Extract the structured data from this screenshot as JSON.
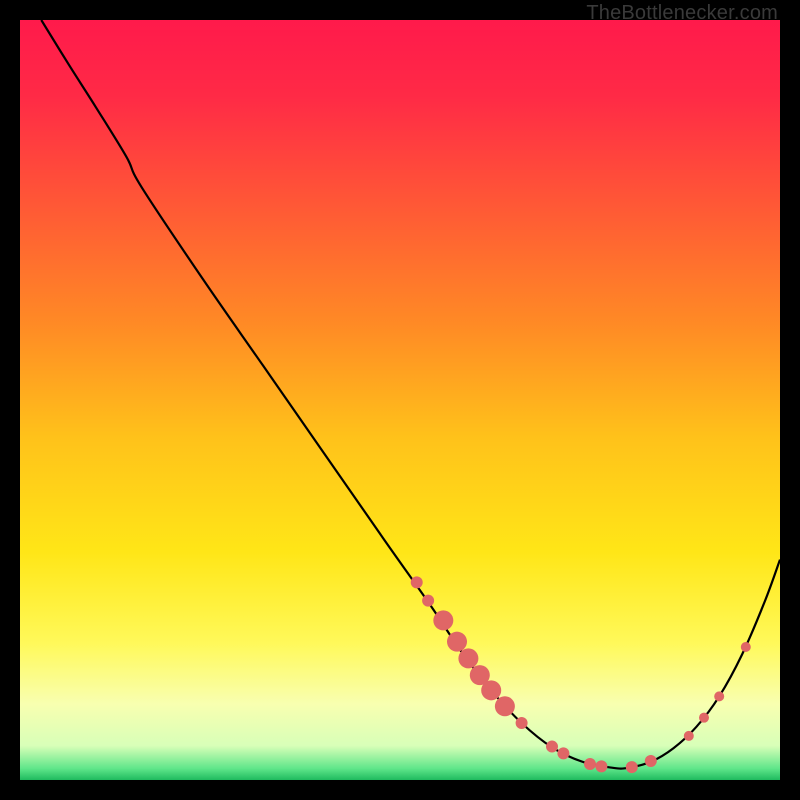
{
  "attribution": "TheBottlenecker.com",
  "chart_data": {
    "type": "line",
    "title": "",
    "xlabel": "",
    "ylabel": "",
    "xlim": [
      0,
      100
    ],
    "ylim": [
      0,
      100
    ],
    "gradient_stops": [
      {
        "offset": 0.0,
        "color": "#ff1a4b"
      },
      {
        "offset": 0.1,
        "color": "#ff2a46"
      },
      {
        "offset": 0.25,
        "color": "#ff5a35"
      },
      {
        "offset": 0.4,
        "color": "#ff8a25"
      },
      {
        "offset": 0.55,
        "color": "#ffc21a"
      },
      {
        "offset": 0.7,
        "color": "#ffe617"
      },
      {
        "offset": 0.82,
        "color": "#fff95a"
      },
      {
        "offset": 0.9,
        "color": "#f8ffb0"
      },
      {
        "offset": 0.955,
        "color": "#d8ffb8"
      },
      {
        "offset": 0.985,
        "color": "#5fe68a"
      },
      {
        "offset": 1.0,
        "color": "#1fba5e"
      }
    ],
    "curve": [
      {
        "x": 2.8,
        "y": 100.0
      },
      {
        "x": 6.5,
        "y": 94.0
      },
      {
        "x": 10.0,
        "y": 88.5
      },
      {
        "x": 14.0,
        "y": 82.0
      },
      {
        "x": 16.0,
        "y": 78.0
      },
      {
        "x": 24.0,
        "y": 66.0
      },
      {
        "x": 32.0,
        "y": 54.5
      },
      {
        "x": 40.0,
        "y": 43.0
      },
      {
        "x": 48.0,
        "y": 31.5
      },
      {
        "x": 54.0,
        "y": 23.0
      },
      {
        "x": 58.0,
        "y": 17.0
      },
      {
        "x": 62.0,
        "y": 11.8
      },
      {
        "x": 66.0,
        "y": 7.5
      },
      {
        "x": 70.0,
        "y": 4.3
      },
      {
        "x": 74.0,
        "y": 2.4
      },
      {
        "x": 78.0,
        "y": 1.6
      },
      {
        "x": 80.0,
        "y": 1.6
      },
      {
        "x": 83.0,
        "y": 2.4
      },
      {
        "x": 86.0,
        "y": 4.2
      },
      {
        "x": 89.0,
        "y": 7.0
      },
      {
        "x": 92.0,
        "y": 11.0
      },
      {
        "x": 95.0,
        "y": 16.5
      },
      {
        "x": 98.0,
        "y": 23.5
      },
      {
        "x": 100.0,
        "y": 29.0
      }
    ],
    "dots": [
      {
        "x": 52.2,
        "y": 26.0,
        "r": 6
      },
      {
        "x": 53.7,
        "y": 23.6,
        "r": 6
      },
      {
        "x": 55.7,
        "y": 21.0,
        "r": 10
      },
      {
        "x": 57.5,
        "y": 18.2,
        "r": 10
      },
      {
        "x": 59.0,
        "y": 16.0,
        "r": 10
      },
      {
        "x": 60.5,
        "y": 13.8,
        "r": 10
      },
      {
        "x": 62.0,
        "y": 11.8,
        "r": 10
      },
      {
        "x": 63.8,
        "y": 9.7,
        "r": 10
      },
      {
        "x": 66.0,
        "y": 7.5,
        "r": 6
      },
      {
        "x": 70.0,
        "y": 4.4,
        "r": 6
      },
      {
        "x": 71.5,
        "y": 3.5,
        "r": 6
      },
      {
        "x": 75.0,
        "y": 2.1,
        "r": 6
      },
      {
        "x": 76.5,
        "y": 1.8,
        "r": 6
      },
      {
        "x": 80.5,
        "y": 1.7,
        "r": 6
      },
      {
        "x": 83.0,
        "y": 2.5,
        "r": 6
      },
      {
        "x": 88.0,
        "y": 5.8,
        "r": 5
      },
      {
        "x": 90.0,
        "y": 8.2,
        "r": 5
      },
      {
        "x": 92.0,
        "y": 11.0,
        "r": 5
      },
      {
        "x": 95.5,
        "y": 17.5,
        "r": 5
      }
    ],
    "dot_color": "#e06666",
    "line_color": "#000000"
  }
}
